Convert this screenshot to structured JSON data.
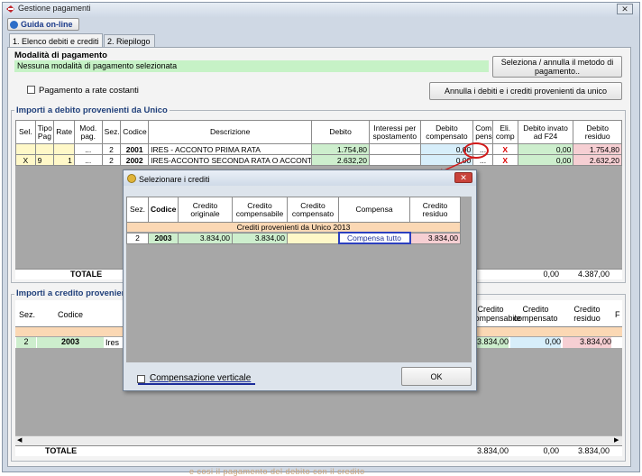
{
  "window": {
    "title": "Gestione pagamenti",
    "close_glyph": "✕"
  },
  "help_button": "Guida on-line",
  "tabs": [
    "1. Elenco debiti e crediti",
    "2. Riepilogo"
  ],
  "payment_mode": {
    "group_label": "Modalità di pagamento",
    "status_text": "Nessuna modalità di pagamento selezionata",
    "select_button": "Seleziona / annulla il metodo di pagamento..",
    "installments_label": "Pagamento a rate costanti",
    "cancel_unico_button": "Annulla i debiti e i crediti provenienti da unico"
  },
  "debits": {
    "section_title": "Importi a debito provenienti da Unico",
    "headers": [
      "Sel.",
      "Tipo Pag",
      "Rate",
      "Mod. pag.",
      "Sez.",
      "Codice",
      "Descrizione",
      "Debito",
      "Interessi per spostamento",
      "Debito compensato",
      "Com pens",
      "Eli. comp",
      "Debito invato ad F24",
      "Debito residuo"
    ],
    "rows": [
      {
        "sel": "",
        "tipo": "",
        "rate": "",
        "mod": "...",
        "sez": "2",
        "codice": "2001",
        "descr": "IRES - ACCONTO PRIMA RATA",
        "debito": "1.754,80",
        "interessi": "",
        "compensato": "0,00",
        "compens": "...",
        "eli": "X",
        "f24": "0,00",
        "residuo": "1.754,80"
      },
      {
        "sel": "X",
        "tipo": "9",
        "rate": "1",
        "mod": "...",
        "sez": "2",
        "codice": "2002",
        "descr": "IRES-ACCONTO SECONDA RATA O ACCONT",
        "debito": "2.632,20",
        "interessi": "",
        "compensato": "0,00",
        "compens": "...",
        "eli": "X",
        "f24": "0,00",
        "residuo": "2.632,20"
      }
    ],
    "total_label": "TOTALE",
    "total_f24": "0,00",
    "total_residuo": "4.387,00"
  },
  "credits": {
    "section_title": "Importi a credito provenienti",
    "headers_left": [
      "Sez.",
      "Codice"
    ],
    "headers_right": [
      "Credito compensabile",
      "Credito compensato",
      "Credito residuo",
      "F"
    ],
    "row": {
      "sez": "2",
      "codice": "2003",
      "descr": "Ires",
      "compensabile": "3.834,00",
      "compensato": "0,00",
      "residuo": "3.834,00"
    },
    "total_label": "TOTALE",
    "totals": [
      "3.834,00",
      "0,00",
      "3.834,00"
    ]
  },
  "dialog": {
    "title": "Selezionare i crediti",
    "close_glyph": "✕",
    "headers": [
      "Sez.",
      "Codice",
      "Credito originale",
      "Credito compensabile",
      "Credito compensato",
      "Compensa",
      "Credito residuo"
    ],
    "group_row": "Crediti provenienti da Unico 2013",
    "row": {
      "sez": "2",
      "codice": "2003",
      "originale": "3.834,00",
      "compensabile": "3.834,00",
      "compensato": "",
      "compensa": "Compensa tutto",
      "residuo": "3.834,00"
    },
    "vertical_label": "Compensazione verticale",
    "ok_button": "OK"
  },
  "bottom_watermark": "e cosi il pagamento del debito con il credito"
}
